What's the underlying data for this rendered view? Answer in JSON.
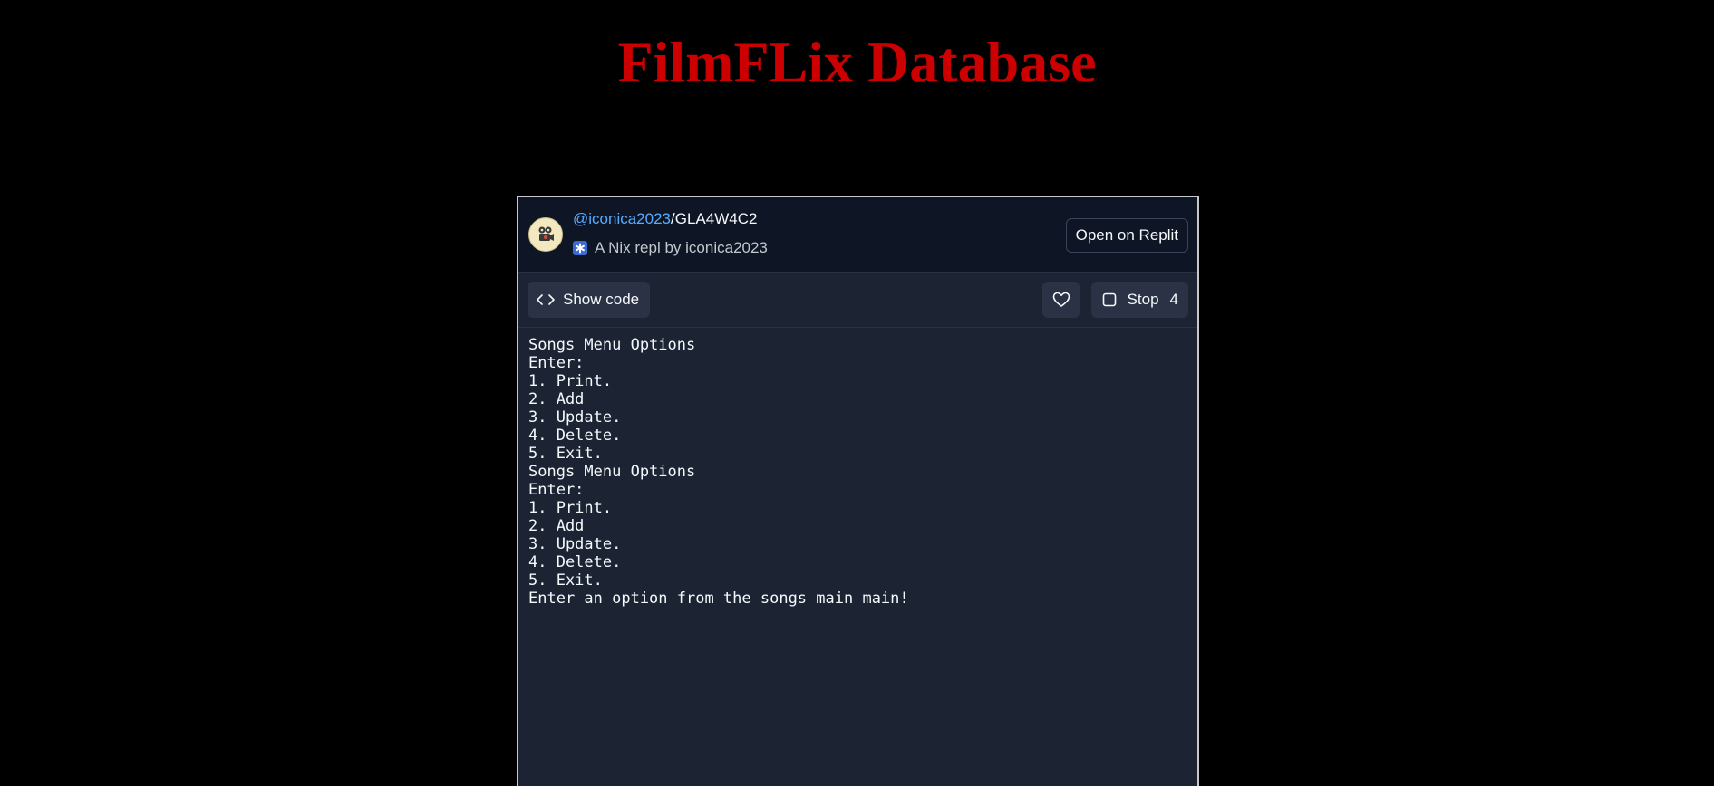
{
  "page": {
    "title": "FilmFLix Database"
  },
  "embed": {
    "user": "@iconica2023",
    "separator": "/",
    "repl_name": "GLA4W4C2",
    "subtitle": "A Nix repl by iconica2023",
    "open_label": "Open on Replit",
    "avatar_icon": "camera-avatar-icon",
    "lang_icon": "nix-snowflake-icon"
  },
  "toolbar": {
    "show_code_label": "Show code",
    "show_code_icon": "code-brackets-icon",
    "like_icon": "heart-icon",
    "stop_label": "Stop",
    "stop_icon": "stop-square-icon",
    "stop_count": "4"
  },
  "console": {
    "lines": [
      "Songs Menu Options",
      "Enter:",
      "1. Print.",
      "2. Add",
      "3. Update.",
      "4. Delete.",
      "5. Exit.",
      "Songs Menu Options",
      "Enter:",
      "1. Print.",
      "2. Add",
      "3. Update.",
      "4. Delete.",
      "5. Exit.",
      "Enter an option from the songs main main!"
    ]
  },
  "colors": {
    "title": "#cc0000",
    "background": "#000000",
    "embed_bg": "#1c2333",
    "header_bg": "#0e1525",
    "link": "#57abff"
  }
}
